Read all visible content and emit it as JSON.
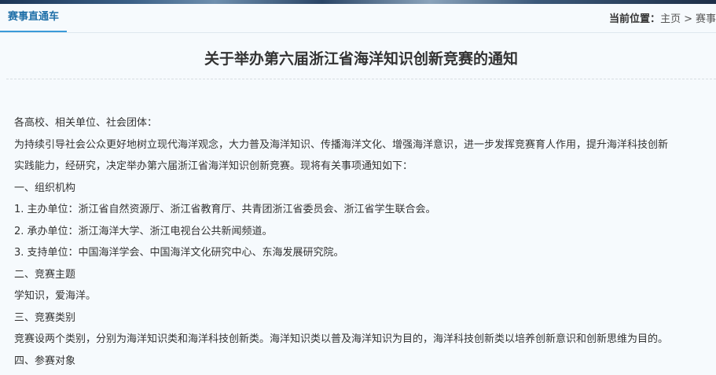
{
  "header": {
    "section_tab": "赛事直通车",
    "breadcrumb": {
      "label": "当前位置：",
      "home": "主页",
      "separator": ">",
      "current": "赛事"
    }
  },
  "article": {
    "title": "关于举办第六届浙江省海洋知识创新竞赛的通知",
    "paragraphs": [
      "各高校、相关单位、社会团体：",
      "为持续引导社会公众更好地树立现代海洋观念，大力普及海洋知识、传播海洋文化、增强海洋意识，进一步发挥竞赛育人作用，提升海洋科技创新",
      "实践能力，经研究，决定举办第六届浙江省海洋知识创新竞赛。现将有关事项通知如下：",
      "一、组织机构",
      "1. 主办单位：浙江省自然资源厅、浙江省教育厅、共青团浙江省委员会、浙江省学生联合会。",
      "2. 承办单位：浙江海洋大学、浙江电视台公共新闻频道。",
      "3. 支持单位：中国海洋学会、中国海洋文化研究中心、东海发展研究院。",
      "二、竞赛主题",
      "学知识，爱海洋。",
      "三、竞赛类别",
      "竞赛设两个类别，分别为海洋知识类和海洋科技创新类。海洋知识类以普及海洋知识为目的，海洋科技创新类以培养创新意识和创新思维为目的。",
      "四、参赛对象"
    ]
  }
}
